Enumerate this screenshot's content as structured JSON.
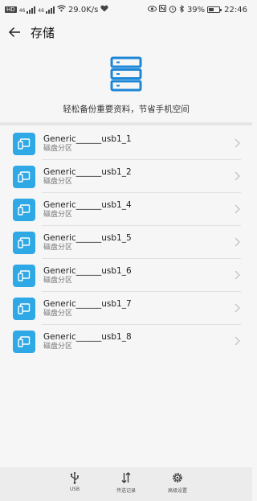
{
  "status_bar": {
    "network_left": "HD",
    "sig1_label": "46",
    "sig2_label": "46",
    "speed": "29.0K/s",
    "battery_percent": "39%",
    "time": "22:46"
  },
  "header": {
    "title": "存储"
  },
  "hero": {
    "text": "轻松备份重要资料，节省手机空间"
  },
  "colors": {
    "accent": "#2fa8e6",
    "hero_icon": "#1c86d7"
  },
  "devices": [
    {
      "name": "Generic______usb1_1",
      "sub": "磁盘分区"
    },
    {
      "name": "Generic______usb1_2",
      "sub": "磁盘分区"
    },
    {
      "name": "Generic______usb1_4",
      "sub": "磁盘分区"
    },
    {
      "name": "Generic______usb1_5",
      "sub": "磁盘分区"
    },
    {
      "name": "Generic______usb1_6",
      "sub": "磁盘分区"
    },
    {
      "name": "Generic______usb1_7",
      "sub": "磁盘分区"
    },
    {
      "name": "Generic______usb1_8",
      "sub": "磁盘分区"
    }
  ],
  "bottom_nav": [
    {
      "label": "USB",
      "icon": "usb-icon"
    },
    {
      "label": "传送记录",
      "icon": "transfer-icon"
    },
    {
      "label": "高级设置",
      "icon": "settings-icon"
    }
  ]
}
